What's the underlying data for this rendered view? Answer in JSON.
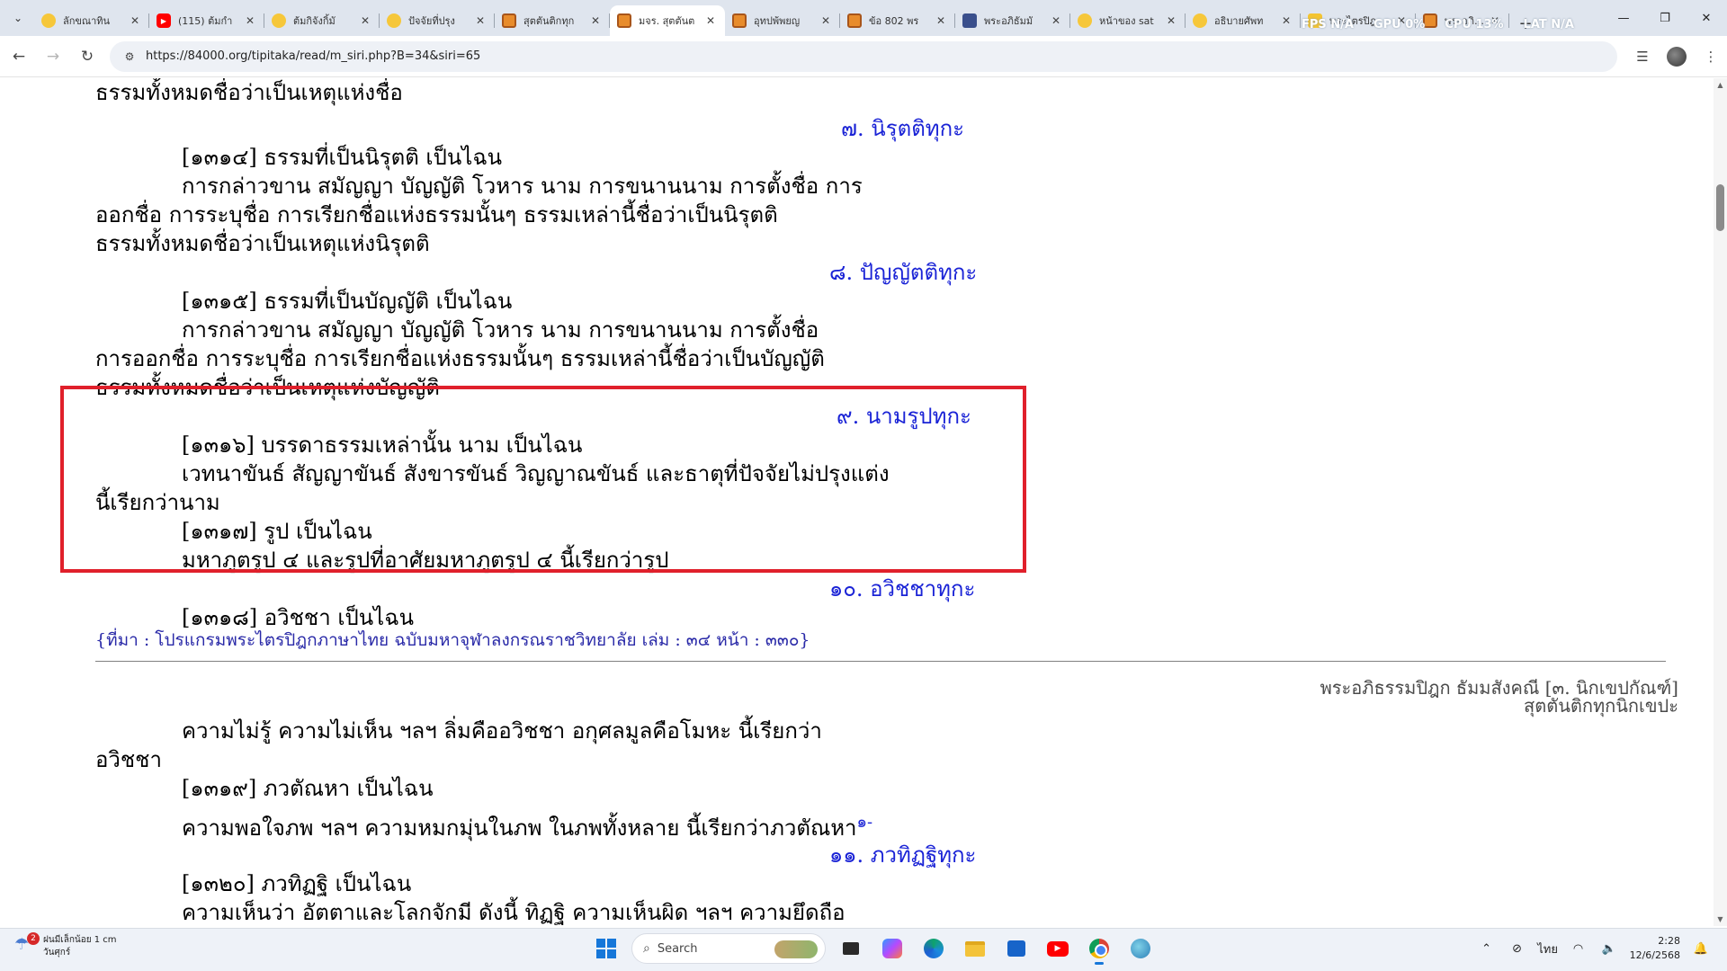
{
  "browser": {
    "tabs": [
      {
        "title": "ลักขณาทิน",
        "favicon": "emoji"
      },
      {
        "title": "(115) ต้มกำ",
        "favicon": "youtube"
      },
      {
        "title": "ต้มกิจังกิ้มั",
        "favicon": "emoji"
      },
      {
        "title": "ปัจจัยที่ปรุง",
        "favicon": "emoji"
      },
      {
        "title": "สุตตันติกทุก",
        "favicon": "book"
      },
      {
        "title": "มจร. สุตตันต",
        "favicon": "book",
        "active": true
      },
      {
        "title": "อุทปพ้พยญ",
        "favicon": "book"
      },
      {
        "title": "ข้อ 802 พร",
        "favicon": "book"
      },
      {
        "title": "พระอภิธัมมั",
        "favicon": "image"
      },
      {
        "title": "หน้าของ sat",
        "favicon": "emoji"
      },
      {
        "title": "อธิบายศัพท",
        "favicon": "emoji"
      },
      {
        "title": "พระไตรปิฎ",
        "favicon": "folder"
      },
      {
        "title": "พระอภิธรร",
        "favicon": "book"
      }
    ],
    "url": "https://84000.org/tipitaka/read/m_siri.php?B=34&siri=65",
    "perf": {
      "gpu": "GPU 0%",
      "cpu": "CPU 13%",
      "lat": "LAT N/A",
      "fps": "FPS N/A"
    }
  },
  "doc": {
    "l01": "ธรรมทั้งหมดชื่อว่าเป็นเหตุแห่งชื่อ",
    "h07": "๗. นิรุตติทุกะ",
    "l02": "[๑๓๑๔] ธรรมที่เป็นนิรุตติ เป็นไฉน",
    "l03": "การกล่าวขาน สมัญญา บัญญัติ โวหาร นาม การขนานนาม การตั้งชื่อ การ",
    "l04": "ออกชื่อ การระบุชื่อ การเรียกชื่อแห่งธรรมนั้นๆ ธรรมเหล่านี้ชื่อว่าเป็นนิรุตติ",
    "l05": "ธรรมทั้งหมดชื่อว่าเป็นเหตุแห่งนิรุตติ",
    "h08": "๘. ปัญญัตติทุกะ",
    "l06": "[๑๓๑๕] ธรรมที่เป็นบัญญัติ เป็นไฉน",
    "l07": "การกล่าวขาน สมัญญา บัญญัติ โวหาร นาม การขนานนาม การตั้งชื่อ",
    "l08": "การออกชื่อ การระบุชื่อ การเรียกชื่อแห่งธรรมนั้นๆ ธรรมเหล่านี้ชื่อว่าเป็นบัญญัติ",
    "l09": "ธรรมทั้งหมดชื่อว่าเป็นเหตุแห่งบัญญัติ",
    "h09": "๙. นามรูปทุกะ",
    "l10": "[๑๓๑๖] บรรดาธรรมเหล่านั้น นาม เป็นไฉน",
    "l11": "เวทนาขันธ์ สัญญาขันธ์ สังขารขันธ์ วิญญาณขันธ์ และธาตุที่ปัจจัยไม่ปรุงแต่ง",
    "l12": "นี้เรียกว่านาม",
    "l13": "[๑๓๑๗] รูป เป็นไฉน",
    "l14": "มหาภูตรูป ๔ และรูปที่อาศัยมหาภูตรูป ๔ นี้เรียกว่ารูป",
    "h10": "๑๐. อวิชชาทุกะ",
    "l15": "[๑๓๑๘] อวิชชา เป็นไฉน",
    "source": "{ที่มา : โปรแกรมพระไตรปิฎกภาษาไทย ฉบับมหาจุฬาลงกรณราชวิทยาลัย เล่ม : ๓๔ หน้า : ๓๓๐}",
    "ref1": "พระอภิธรรมปิฎก ธัมมสังคณี [๓. นิกเขปกัณฑ์]",
    "ref2": "สุตตันติกทุกนิกเขปะ",
    "l16": "ความไม่รู้ ความไม่เห็น ฯลฯ ลิ่มคืออวิชชา อกุศลมูลคือโมหะ นี้เรียกว่า",
    "l17": "อวิชชา",
    "l18": "[๑๓๑๙] ภวตัณหา เป็นไฉน",
    "l19": "ความพอใจภพ ฯลฯ ความหมกมุ่นในภพ ในภพทั้งหลาย นี้เรียกว่าภวตัณหา",
    "note1": "๑-",
    "h11": "๑๑. ภวทิฏฐิทุกะ",
    "l20": "[๑๓๒๐] ภวทิฏฐิ เป็นไฉน",
    "l21": "ความเห็นว่า อัตตาและโลกจักมี ดังนี้ ทิฏฐิ ความเห็นผิด ฯลฯ ความยึดถือ"
  },
  "taskbar": {
    "weather_line1": "ฝนมีเล็กน้อย 1 cm",
    "weather_line2": "วันศุกร์",
    "weather_badge": "2",
    "search_placeholder": "Search",
    "lang": "ไทย",
    "time": "2:28",
    "date": "12/6/2568"
  }
}
